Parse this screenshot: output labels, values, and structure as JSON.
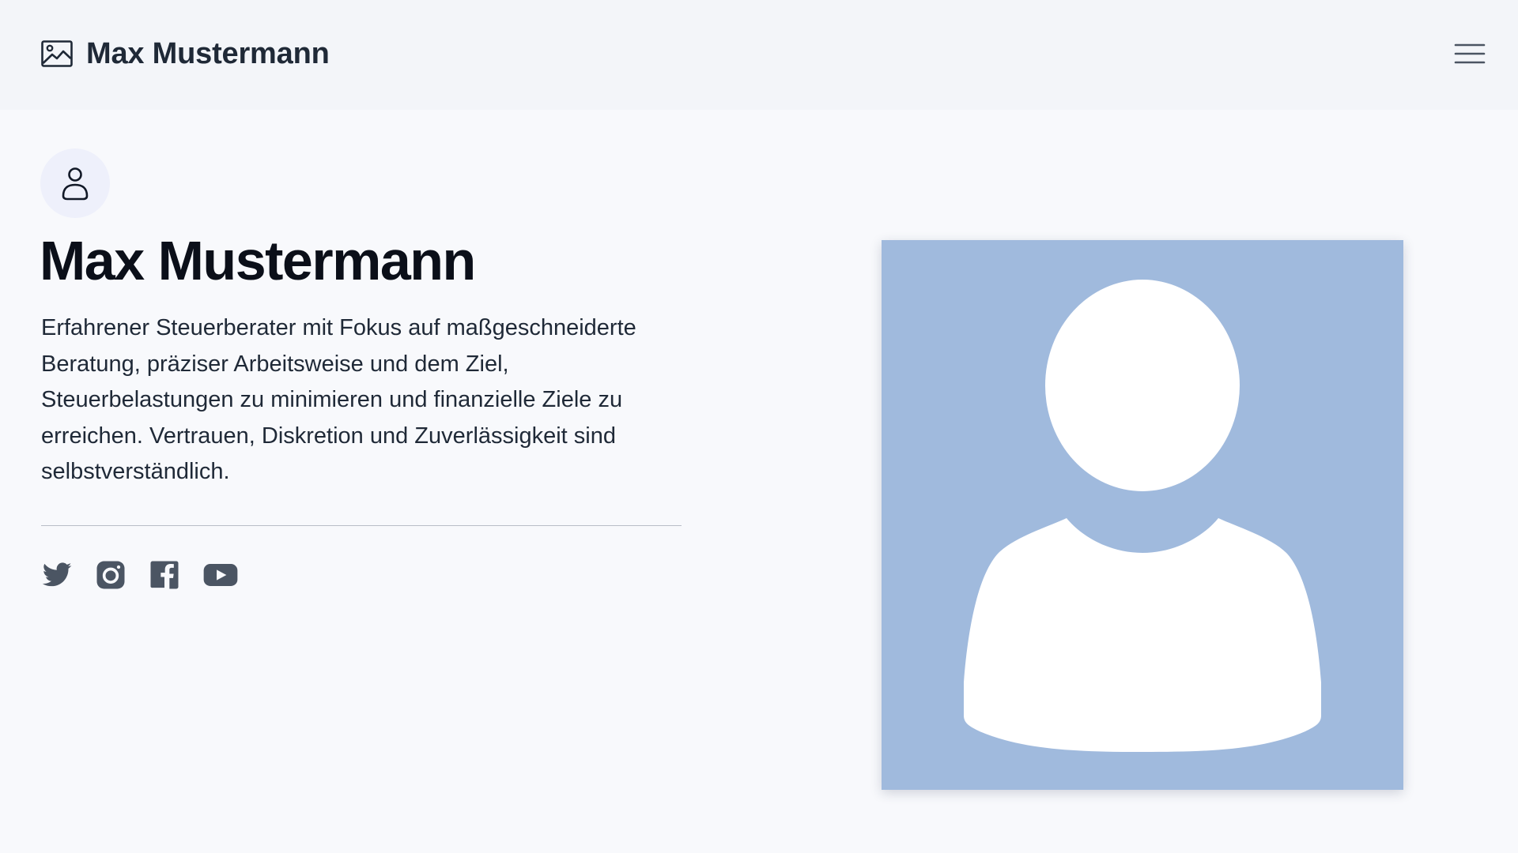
{
  "header": {
    "brand_name": "Max Mustermann",
    "brand_icon": "image-icon",
    "menu_icon": "hamburger-menu-icon"
  },
  "profile": {
    "avatar_icon": "user-icon",
    "name": "Max Mustermann",
    "bio": "Erfahrener Steuerberater mit Fokus auf maßgeschneiderte Beratung, präziser Arbeitsweise und dem Ziel, Steuerbelastungen zu minimieren und finanzielle Ziele zu erreichen. Vertrauen, Diskretion und Zuverlässigkeit sind selbstverständlich."
  },
  "socials": [
    {
      "icon": "twitter-icon"
    },
    {
      "icon": "instagram-icon"
    },
    {
      "icon": "facebook-icon"
    },
    {
      "icon": "youtube-icon"
    }
  ],
  "portrait": {
    "icon": "person-silhouette-icon",
    "background_color": "#a0badd"
  },
  "colors": {
    "page_background": "#f8f9fc",
    "header_background": "#f3f5f9",
    "text": "#1f2937",
    "icon_gray": "#4b5563"
  }
}
